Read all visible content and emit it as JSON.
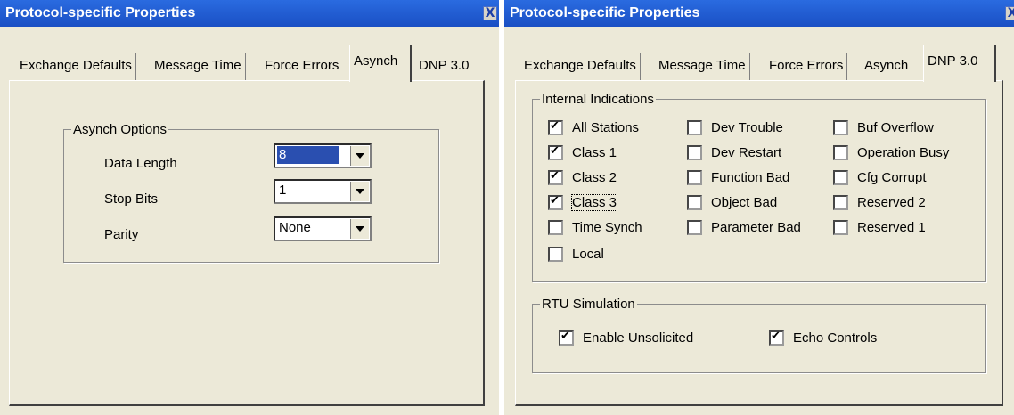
{
  "left": {
    "title": "Protocol-specific Properties",
    "close_glyph": "X",
    "tabs": [
      "Exchange Defaults",
      "Message Time",
      "Force Errors",
      "Asynch",
      "DNP 3.0"
    ],
    "active_tab": "Asynch",
    "group_title": "Asynch Options",
    "fields": [
      {
        "label": "Data Length",
        "value": "8"
      },
      {
        "label": "Stop Bits",
        "value": "1"
      },
      {
        "label": "Parity",
        "value": "None"
      }
    ]
  },
  "right": {
    "title": "Protocol-specific Properties",
    "close_glyph": "X",
    "tabs": [
      "Exchange Defaults",
      "Message Time",
      "Force Errors",
      "Asynch",
      "DNP 3.0"
    ],
    "active_tab": "DNP 3.0",
    "indications_title": "Internal Indications",
    "indications": {
      "all_stations": {
        "label": "All Stations",
        "checked": true
      },
      "class_1": {
        "label": "Class 1",
        "checked": true
      },
      "class_2": {
        "label": "Class 2",
        "checked": true
      },
      "class_3": {
        "label": "Class 3",
        "checked": true
      },
      "time_synch": {
        "label": "Time Synch",
        "checked": false
      },
      "local": {
        "label": "Local",
        "checked": false
      },
      "dev_trouble": {
        "label": "Dev Trouble",
        "checked": false
      },
      "dev_restart": {
        "label": "Dev Restart",
        "checked": false
      },
      "function_bad": {
        "label": "Function Bad",
        "checked": false
      },
      "object_bad": {
        "label": "Object Bad",
        "checked": false
      },
      "parameter_bad": {
        "label": "Parameter Bad",
        "checked": false
      },
      "buf_overflow": {
        "label": "Buf Overflow",
        "checked": false
      },
      "operation_busy": {
        "label": "Operation Busy",
        "checked": false
      },
      "cfg_corrupt": {
        "label": "Cfg Corrupt",
        "checked": false
      },
      "reserved_2": {
        "label": "Reserved 2",
        "checked": false
      },
      "reserved_1": {
        "label": "Reserved 1",
        "checked": false
      }
    },
    "rtu_title": "RTU Simulation",
    "rtu": {
      "enable_unsolicited": {
        "label": "Enable Unsolicited",
        "checked": true
      },
      "echo_controls": {
        "label": "Echo Controls",
        "checked": true
      }
    }
  },
  "colors": {
    "titlebar": "#1a4fc4",
    "dialog": "#ece9d8",
    "selection": "#2a4fb0"
  }
}
